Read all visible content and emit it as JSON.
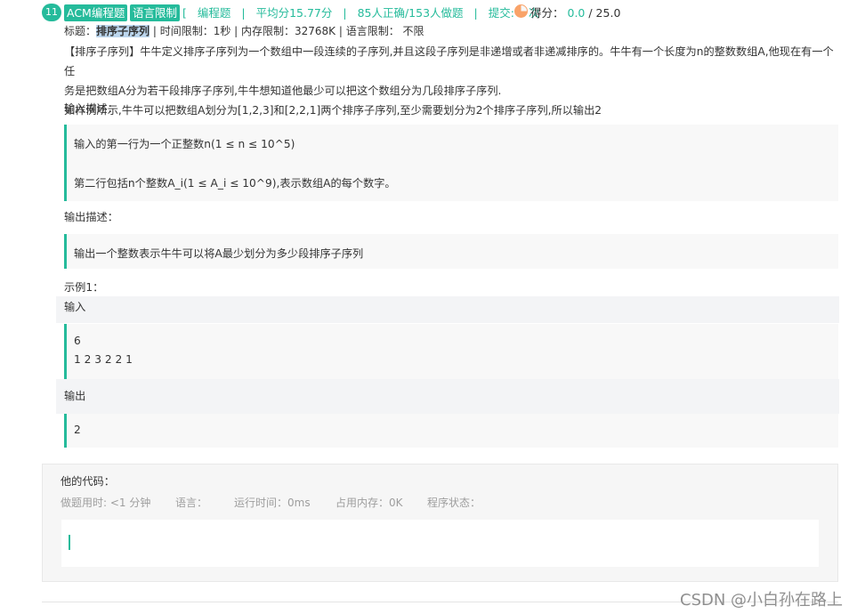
{
  "header": {
    "number": "11",
    "tag_acm": "ACM编程题",
    "tag_lang": "语言限制",
    "bracket": "[",
    "type": "编程题",
    "sep": "|",
    "avg": "平均分15.77分",
    "correct": "85人正确/153人做题",
    "submit": "提交: 0 次",
    "score_label": "得分：",
    "score_got": "0.0",
    "score_total": "/ 25.0"
  },
  "title_line": {
    "prefix": "标题：",
    "title": "排序子序列",
    "rest": " | 时间限制：1秒 | 内存限制：32768K | 语言限制： 不限"
  },
  "description": {
    "line1": "【排序子序列】牛牛定义排序子序列为一个数组中一段连续的子序列,并且这段子序列是非递增或者非递减排序的。牛牛有一个长度为n的整数数组A,他现在有一个任",
    "line2": "务是把数组A分为若干段排序子序列,牛牛想知道他最少可以把这个数组分为几段排序子序列.",
    "line3": "如样例所示,牛牛可以把数组A划分为[1,2,3]和[2,2,1]两个排序子序列,至少需要划分为2个排序子序列,所以输出2"
  },
  "input_desc": {
    "label": "输入描述：",
    "line1": "输入的第一行为一个正整数n(1 ≤ n ≤ 10^5)",
    "line2": "第二行包括n个整数A_i(1 ≤ A_i ≤ 10^9),表示数组A的每个数字。"
  },
  "output_desc": {
    "label": "输出描述：",
    "line1": "输出一个整数表示牛牛可以将A最少划分为多少段排序子序列"
  },
  "example": {
    "label": "示例1：",
    "input_label": "输入",
    "input_line1": "6",
    "input_line2": "1 2 3 2 2 1",
    "output_label": "输出",
    "output_value": "2"
  },
  "code_panel": {
    "title": "他的代码：",
    "time_used": "做题用时: <1 分钟",
    "language": "语言：",
    "run_time": "运行时间：0ms",
    "memory": "占用内存：0K",
    "status": "程序状态："
  },
  "watermark": "CSDN @小白孙在路上",
  "colors": {
    "accent": "#25bb9b",
    "highlight": "#bcd6ee",
    "score_icon": "#f9a369"
  }
}
